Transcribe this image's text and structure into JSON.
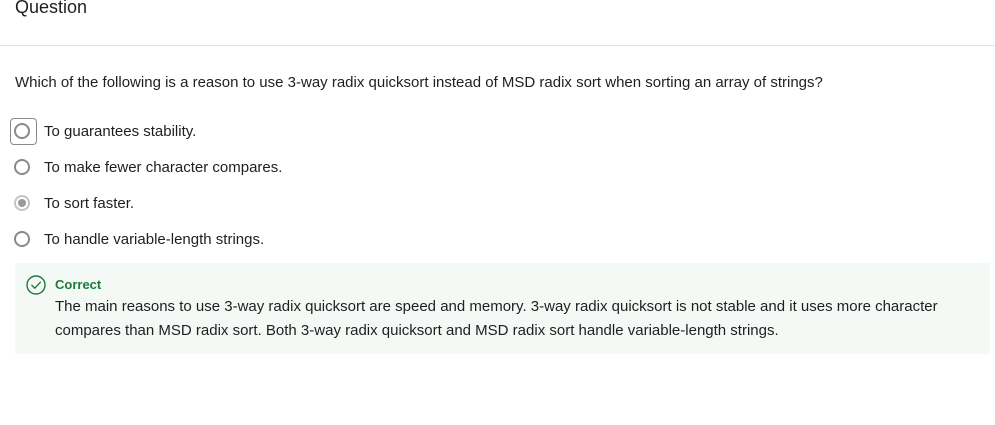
{
  "header": {
    "title": "Question"
  },
  "question": {
    "text": "Which of the following is a reason to use 3-way radix quicksort instead of MSD radix sort when sorting an array of strings?",
    "options": [
      {
        "label": "To guarantees stability.",
        "selected": false,
        "focused": true
      },
      {
        "label": "To make fewer character compares.",
        "selected": false,
        "focused": false
      },
      {
        "label": "To sort faster.",
        "selected": true,
        "focused": false
      },
      {
        "label": "To handle variable-length strings.",
        "selected": false,
        "focused": false
      }
    ]
  },
  "feedback": {
    "icon": "check-circle-icon",
    "status": "Correct",
    "status_color": "#1e7a3c",
    "text": "The main reasons to use 3-way radix quicksort are speed and memory. 3-way radix quicksort is not stable and it uses more character compares than MSD radix sort. Both 3-way radix quicksort and MSD radix sort handle variable-length strings."
  }
}
